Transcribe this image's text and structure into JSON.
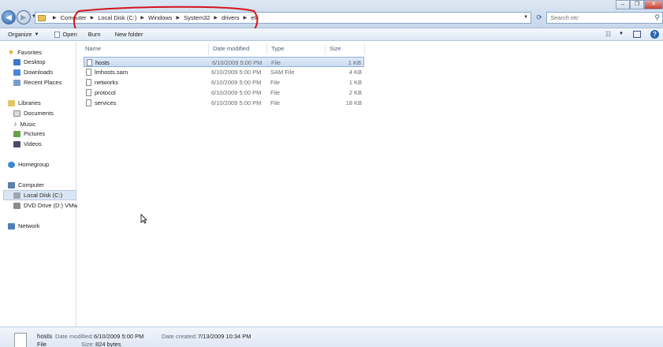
{
  "address": {
    "crumbs": [
      "Computer",
      "Local Disk (C:)",
      "Windows",
      "System32",
      "drivers",
      "etc"
    ]
  },
  "search": {
    "placeholder": "Search etc"
  },
  "toolbar": {
    "organize": "Organize",
    "open": "Open",
    "burn": "Burn",
    "new_folder": "New folder"
  },
  "nav": {
    "favorites": "Favorites",
    "desktop": "Desktop",
    "downloads": "Downloads",
    "recent": "Recent Places",
    "libraries": "Libraries",
    "documents": "Documents",
    "music": "Music",
    "pictures": "Pictures",
    "videos": "Videos",
    "homegroup": "Homegroup",
    "computer": "Computer",
    "local_disk": "Local Disk (C:)",
    "dvd": "DVD Drive (D:) VMw",
    "network": "Network"
  },
  "columns": {
    "name": "Name",
    "date": "Date modified",
    "type": "Type",
    "size": "Size"
  },
  "files": [
    {
      "name": "hosts",
      "date": "6/10/2009 5:00 PM",
      "type": "File",
      "size": "1 KB"
    },
    {
      "name": "lmhosts.sam",
      "date": "6/10/2009 5:00 PM",
      "type": "SAM File",
      "size": "4 KB"
    },
    {
      "name": "networks",
      "date": "6/10/2009 5:00 PM",
      "type": "File",
      "size": "1 KB"
    },
    {
      "name": "protocol",
      "date": "6/10/2009 5:00 PM",
      "type": "File",
      "size": "2 KB"
    },
    {
      "name": "services",
      "date": "6/10/2009 5:00 PM",
      "type": "File",
      "size": "18 KB"
    }
  ],
  "details": {
    "name": "hosts",
    "modified_label": "Date modified:",
    "modified": "6/10/2009 5:00 PM",
    "created_label": "Date created:",
    "created": "7/13/2009 10:34 PM",
    "type": "File",
    "size_label": "Size:",
    "size": "824 bytes"
  },
  "colors": {
    "annotation": "#d4141c",
    "selection": "#c9dcf3"
  }
}
